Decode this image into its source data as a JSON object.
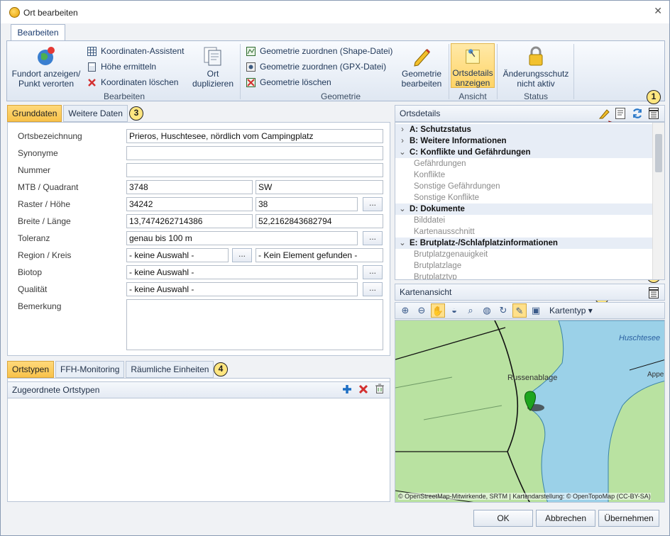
{
  "window": {
    "title": "Ort bearbeiten",
    "close_label": "✕"
  },
  "ribbon": {
    "tab": "Bearbeiten",
    "group_bearbeiten": {
      "label": "Bearbeiten",
      "fundort_line1": "Fundort anzeigen/",
      "fundort_line2": "Punkt verorten",
      "koordinaten_assistent": "Koordinaten-Assistent",
      "hoehe_ermitteln": "Höhe ermitteln",
      "koordinaten_loeschen": "Koordinaten löschen",
      "ort_line1": "Ort",
      "ort_line2": "duplizieren"
    },
    "group_geometrie": {
      "label": "Geometrie",
      "shape": "Geometrie zuordnen (Shape-Datei)",
      "gpx": "Geometrie zuordnen (GPX-Datei)",
      "loeschen": "Geometrie löschen",
      "bearbeiten_line1": "Geometrie",
      "bearbeiten_line2": "bearbeiten"
    },
    "group_ansicht": {
      "label": "Ansicht",
      "line1": "Ortsdetails",
      "line2": "anzeigen"
    },
    "group_status": {
      "label": "Status",
      "line1": "Änderungsschutz",
      "line2": "nicht aktiv"
    }
  },
  "callouts": {
    "c1": "1",
    "c2": "2",
    "c3": "3",
    "c4": "4",
    "c5": "1"
  },
  "form": {
    "tabs": [
      "Grunddaten",
      "Weitere Daten"
    ],
    "labels": {
      "ortsbezeichnung": "Ortsbezeichnung",
      "synonyme": "Synonyme",
      "nummer": "Nummer",
      "mtb": "MTB / Quadrant",
      "raster": "Raster / Höhe",
      "breite": "Breite / Länge",
      "toleranz": "Toleranz",
      "region": "Region / Kreis",
      "biotop": "Biotop",
      "qualitaet": "Qualität",
      "bemerkung": "Bemerkung"
    },
    "values": {
      "ortsbezeichnung": "Prieros, Huschtesee, nördlich vom Campingplatz",
      "synonyme": "",
      "nummer": "",
      "mtb": "3748",
      "quadrant": "SW",
      "raster": "34242",
      "hoehe": "38",
      "breite": "13,7474262714386",
      "laenge": "52,2162843682794",
      "toleranz": "genau bis 100 m",
      "region": "- keine Auswahl -",
      "kreis": "- Kein Element gefunden -",
      "biotop": "- keine Auswahl -",
      "qualitaet": "- keine Auswahl -",
      "bemerkung": ""
    },
    "ellipsis": "..."
  },
  "lower": {
    "tabs": [
      "Ortstypen",
      "FFH-Monitoring",
      "Räumliche Einheiten"
    ],
    "header": "Zugeordnete Ortstypen"
  },
  "details": {
    "title": "Ortsdetails",
    "rows": [
      {
        "type": "cat",
        "arrow": "›",
        "text": "A:  Schutzstatus"
      },
      {
        "type": "cat",
        "arrow": "›",
        "text": "B:  Weitere Informationen"
      },
      {
        "type": "cat",
        "arrow": "⌄",
        "text": "C:  Konflikte und Gefährdungen"
      },
      {
        "type": "item",
        "text": "Gefährdungen"
      },
      {
        "type": "item",
        "text": "Konflikte"
      },
      {
        "type": "item",
        "text": "Sonstige Gefährdungen"
      },
      {
        "type": "item",
        "text": "Sonstige Konflikte"
      },
      {
        "type": "cat",
        "arrow": "⌄",
        "text": "D:  Dokumente"
      },
      {
        "type": "item",
        "text": "Bilddatei"
      },
      {
        "type": "item",
        "text": "Kartenausschnitt"
      },
      {
        "type": "cat",
        "arrow": "⌄",
        "text": "E:  Brutplatz-/Schlafplatzinformationen"
      },
      {
        "type": "item",
        "text": "Brutplatzgenauigkeit"
      },
      {
        "type": "item",
        "text": "Brutplatzlage"
      },
      {
        "type": "item",
        "text": "Brutplatztyp"
      }
    ]
  },
  "map": {
    "title": "Kartenansicht",
    "kartentyp": "Kartentyp",
    "labels": {
      "huschtesee": "Huschtesee",
      "russenablage": "Russenablage",
      "appel": "Appel"
    },
    "attribution": "© OpenStreetMap-Mitwirkende, SRTM | Kartendarstellung: © OpenTopoMap (CC-BY-SA)"
  },
  "buttons": {
    "ok": "OK",
    "abbrechen": "Abbrechen",
    "uebernehmen": "Übernehmen"
  }
}
